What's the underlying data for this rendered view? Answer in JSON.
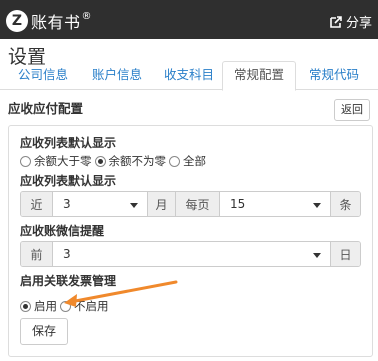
{
  "app": {
    "logo_letter": "Z",
    "name": "账有书",
    "reg": "®",
    "share_label": "分享"
  },
  "page": {
    "title": "设置"
  },
  "tabs": [
    {
      "label": "公司信息",
      "active": false
    },
    {
      "label": "账户信息",
      "active": false
    },
    {
      "label": "收支科目",
      "active": false
    },
    {
      "label": "常规配置",
      "active": true
    },
    {
      "label": "常规代码",
      "active": false
    }
  ],
  "section": {
    "title": "应收应付配置",
    "back_label": "返回"
  },
  "form": {
    "list_default_label": "应收列表默认显示",
    "list_default_options": [
      "余额大于零",
      "余额不为零",
      "全部"
    ],
    "list_default_selected": "余额不为零",
    "list_period_label": "应收列表默认显示",
    "period_prefix": "近",
    "period_value": "3",
    "period_unit": "月",
    "per_page_label": "每页",
    "per_page_value": "15",
    "per_page_unit": "条",
    "wechat_label": "应收账微信提醒",
    "wechat_prefix": "前",
    "wechat_value": "3",
    "wechat_unit": "日",
    "invoice_label": "启用关联发票管理",
    "invoice_options": [
      "启用",
      "不启用"
    ],
    "invoice_selected": "启用",
    "save_label": "保存"
  },
  "colors": {
    "topbar": "#2f2f2f",
    "link": "#2a7fc9",
    "annotation_arrow": "#f0892c"
  }
}
